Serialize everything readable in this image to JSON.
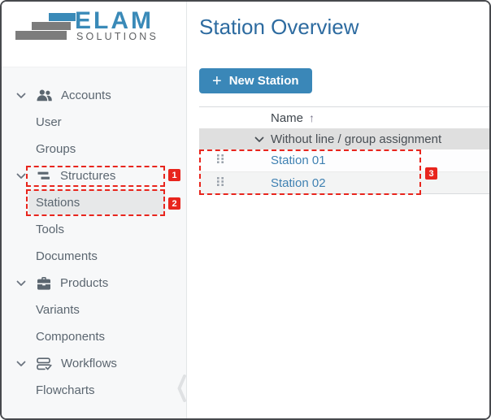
{
  "brand": {
    "name": "ELAM",
    "subtitle": "SOLUTIONS"
  },
  "sidebar": {
    "items": [
      {
        "label": "Accounts",
        "type": "parent",
        "icon": "users-icon"
      },
      {
        "label": "User",
        "type": "child"
      },
      {
        "label": "Groups",
        "type": "child"
      },
      {
        "label": "Structures",
        "type": "parent",
        "icon": "hierarchy-bars-icon"
      },
      {
        "label": "Stations",
        "type": "child",
        "selected": true
      },
      {
        "label": "Tools",
        "type": "child"
      },
      {
        "label": "Documents",
        "type": "child"
      },
      {
        "label": "Products",
        "type": "parent",
        "icon": "briefcase-icon"
      },
      {
        "label": "Variants",
        "type": "child"
      },
      {
        "label": "Components",
        "type": "child"
      },
      {
        "label": "Workflows",
        "type": "parent",
        "icon": "workflow-stack-icon"
      },
      {
        "label": "Flowcharts",
        "type": "child"
      }
    ]
  },
  "main": {
    "title": "Station Overview",
    "new_station_button": {
      "icon": "+",
      "label": "New Station"
    },
    "table": {
      "name_column": "Name",
      "sort_indicator": "↑",
      "group_header": "Without line / group assignment",
      "rows": [
        {
          "name": "Station 01"
        },
        {
          "name": "Station 02"
        }
      ]
    }
  },
  "annotations": {
    "badge1": "1",
    "badge2": "2",
    "badge3": "3"
  },
  "colors": {
    "accent_blue": "#3a87b8",
    "title_blue": "#2d6ba0",
    "link_blue": "#3f81b2",
    "annotation_red": "#e8251d",
    "logo_blue": "#3a8ab8",
    "logo_gray": "#7c7c7c",
    "group_row_gray": "#dfdfdf"
  }
}
